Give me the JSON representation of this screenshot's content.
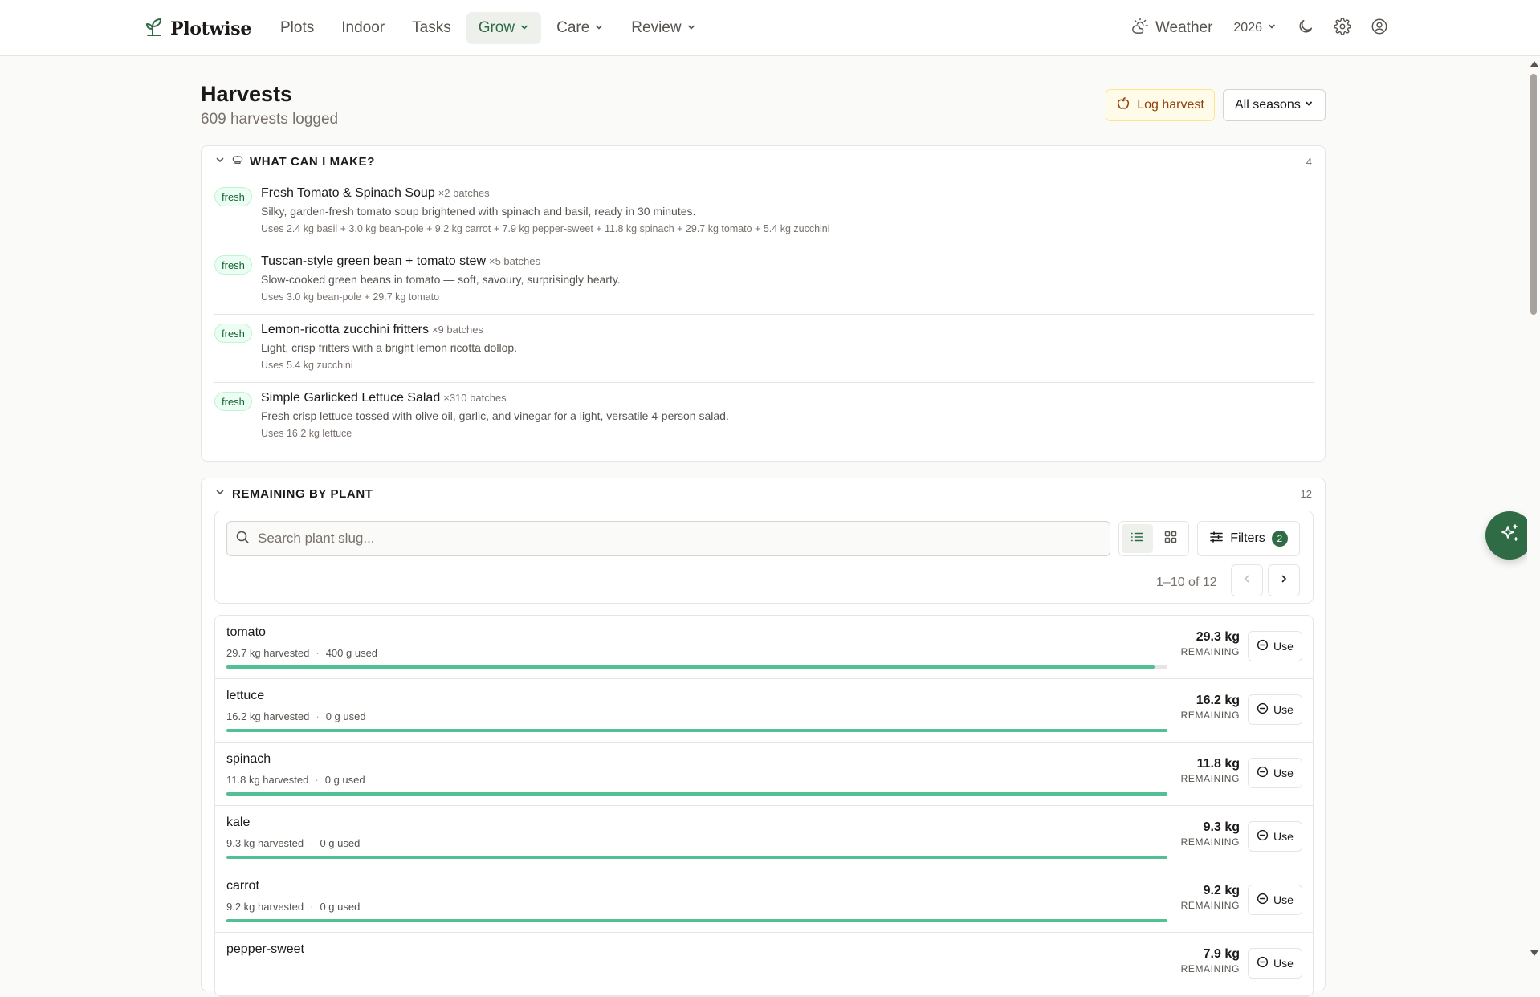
{
  "app": {
    "name": "Plotwise"
  },
  "nav": {
    "links": [
      {
        "label": "Plots",
        "dropdown": false,
        "active": false
      },
      {
        "label": "Indoor",
        "dropdown": false,
        "active": false
      },
      {
        "label": "Tasks",
        "dropdown": false,
        "active": false
      },
      {
        "label": "Grow",
        "dropdown": true,
        "active": true
      },
      {
        "label": "Care",
        "dropdown": true,
        "active": false
      },
      {
        "label": "Review",
        "dropdown": true,
        "active": false
      }
    ],
    "weather_label": "Weather",
    "year": "2026",
    "icons": [
      "leaf-logo-icon",
      "weather-sun-icon",
      "moon-icon",
      "gear-icon",
      "user-circle-icon"
    ]
  },
  "header": {
    "title": "Harvests",
    "subtitle": "609 harvests logged",
    "log_button": "Log harvest",
    "season_select": "All seasons"
  },
  "recipes_card": {
    "title": "WHAT CAN I MAKE?",
    "count": "4",
    "items": [
      {
        "badge": "fresh",
        "title": "Fresh Tomato & Spinach Soup",
        "batches": "×2 batches",
        "description": "Silky, garden-fresh tomato soup brightened with spinach and basil, ready in 30 minutes.",
        "uses": "Uses 2.4 kg basil + 3.0 kg bean-pole + 9.2 kg carrot + 7.9 kg pepper-sweet + 11.8 kg spinach + 29.7 kg tomato + 5.4 kg zucchini"
      },
      {
        "badge": "fresh",
        "title": "Tuscan-style green bean + tomato stew",
        "batches": "×5 batches",
        "description": "Slow-cooked green beans in tomato — soft, savoury, surprisingly hearty.",
        "uses": "Uses 3.0 kg bean-pole + 29.7 kg tomato"
      },
      {
        "badge": "fresh",
        "title": "Lemon-ricotta zucchini fritters",
        "batches": "×9 batches",
        "description": "Light, crisp fritters with a bright lemon ricotta dollop.",
        "uses": "Uses 5.4 kg zucchini"
      },
      {
        "badge": "fresh",
        "title": "Simple Garlicked Lettuce Salad",
        "batches": "×310 batches",
        "description": "Fresh crisp lettuce tossed with olive oil, garlic, and vinegar for a light, versatile 4-person salad.",
        "uses": "Uses 16.2 kg lettuce"
      }
    ]
  },
  "remaining_card": {
    "title": "REMAINING BY PLANT",
    "count": "12",
    "search_placeholder": "Search plant slug...",
    "filters_label": "Filters",
    "filters_count": "2",
    "page_info": "1–10 of 12",
    "remaining_label": "REMAINING",
    "use_label": "Use",
    "plants": [
      {
        "name": "tomato",
        "harvested": "29.7 kg harvested",
        "used": "400 g used",
        "remaining": "29.3 kg",
        "fraction": 0.9865
      },
      {
        "name": "lettuce",
        "harvested": "16.2 kg harvested",
        "used": "0 g used",
        "remaining": "16.2 kg",
        "fraction": 1.0
      },
      {
        "name": "spinach",
        "harvested": "11.8 kg harvested",
        "used": "0 g used",
        "remaining": "11.8 kg",
        "fraction": 1.0
      },
      {
        "name": "kale",
        "harvested": "9.3 kg harvested",
        "used": "0 g used",
        "remaining": "9.3 kg",
        "fraction": 1.0
      },
      {
        "name": "carrot",
        "harvested": "9.2 kg harvested",
        "used": "0 g used",
        "remaining": "9.2 kg",
        "fraction": 1.0
      },
      {
        "name": "pepper-sweet",
        "harvested": "",
        "used": "",
        "remaining": "7.9 kg",
        "fraction": 1.0
      }
    ]
  },
  "colors": {
    "brand": "#2f6b45",
    "progress": "#52bf94",
    "fresh_badge_bg": "#ecfdf3",
    "log_button_bg": "#fefce8"
  }
}
